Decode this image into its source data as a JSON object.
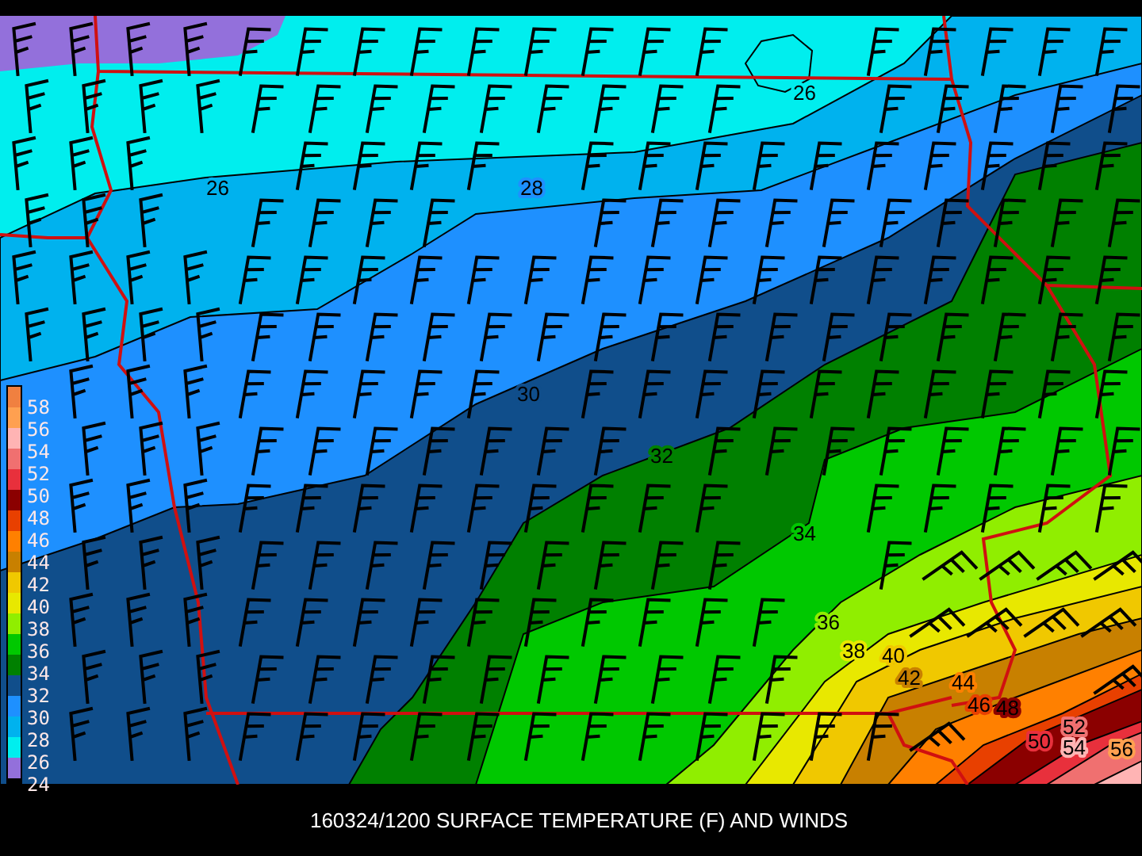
{
  "map": {
    "contour_labels": [
      "26",
      "26",
      "28",
      "30",
      "32",
      "34",
      "36",
      "38",
      "40",
      "42",
      "44",
      "46",
      "48",
      "50",
      "52",
      "54",
      "56"
    ]
  },
  "legend": {
    "swatches": [
      {
        "color": "#f08040"
      },
      {
        "color": "#ffa050"
      },
      {
        "color": "#ffb4b4"
      },
      {
        "color": "#f07070"
      },
      {
        "color": "#e8303c"
      },
      {
        "color": "#8b0000"
      },
      {
        "color": "#e84000"
      },
      {
        "color": "#ff8000"
      },
      {
        "color": "#c88000"
      },
      {
        "color": "#f0c800"
      },
      {
        "color": "#e8e800"
      },
      {
        "color": "#90ee00"
      },
      {
        "color": "#00c800"
      },
      {
        "color": "#008000"
      },
      {
        "color": "#104e8b"
      },
      {
        "color": "#1e90ff"
      },
      {
        "color": "#00b2ee"
      },
      {
        "color": "#00eeee"
      },
      {
        "color": "#9370db"
      }
    ],
    "labels": [
      "58",
      "56",
      "54",
      "52",
      "50",
      "48",
      "46",
      "44",
      "42",
      "40",
      "38",
      "36",
      "34",
      "32",
      "30",
      "28",
      "26",
      "24"
    ]
  },
  "title": "160324/1200 SURFACE TEMPERATURE (F) AND WINDS"
}
